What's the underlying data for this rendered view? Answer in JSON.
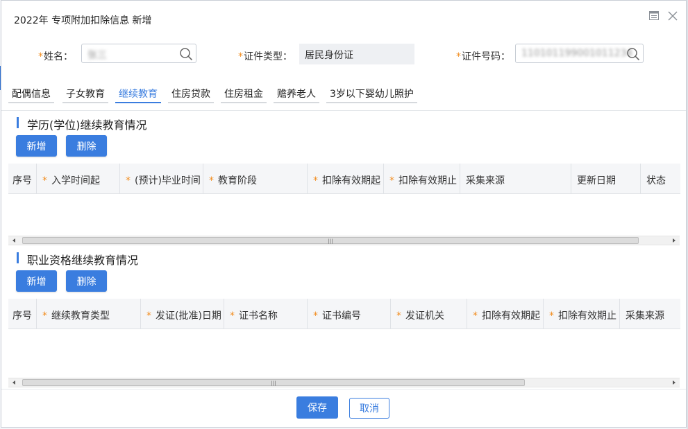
{
  "dialog": {
    "title": "2022年 专项附加扣除信息 新增"
  },
  "form": {
    "name_label": "姓名：",
    "name_value": "张三",
    "id_type_label": "证件类型：",
    "id_type_value": "居民身份证",
    "id_number_label": "证件号码：",
    "id_number_value": "110101199001011234"
  },
  "tabs": [
    {
      "label": "配偶信息"
    },
    {
      "label": "子女教育"
    },
    {
      "label": "继续教育"
    },
    {
      "label": "住房贷款"
    },
    {
      "label": "住房租金"
    },
    {
      "label": "赡养老人"
    },
    {
      "label": "3岁以下婴幼儿照护"
    }
  ],
  "active_tab": "继续教育",
  "section1": {
    "title": "学历(学位)继续教育情况",
    "add_label": "新增",
    "delete_label": "删除",
    "columns": [
      {
        "label": "序号",
        "required": false
      },
      {
        "label": "入学时间起",
        "required": true
      },
      {
        "label": "(预计)毕业时间",
        "required": true
      },
      {
        "label": "教育阶段",
        "required": true
      },
      {
        "label": "扣除有效期起",
        "required": true
      },
      {
        "label": "扣除有效期止",
        "required": true
      },
      {
        "label": "采集来源",
        "required": false
      },
      {
        "label": "更新日期",
        "required": false
      },
      {
        "label": "状态",
        "required": false
      }
    ],
    "rows": []
  },
  "section2": {
    "title": "职业资格继续教育情况",
    "add_label": "新增",
    "delete_label": "删除",
    "columns": [
      {
        "label": "序号",
        "required": false
      },
      {
        "label": "继续教育类型",
        "required": true
      },
      {
        "label": "发证(批准)日期",
        "required": true
      },
      {
        "label": "证书名称",
        "required": true
      },
      {
        "label": "证书编号",
        "required": true
      },
      {
        "label": "发证机关",
        "required": true
      },
      {
        "label": "扣除有效期起",
        "required": true
      },
      {
        "label": "扣除有效期止",
        "required": true
      },
      {
        "label": "采集来源",
        "required": false
      }
    ],
    "rows": []
  },
  "footer": {
    "save_label": "保存",
    "cancel_label": "取消"
  },
  "icons": {
    "maximize": "maximize-icon",
    "close": "close-icon",
    "search": "search-icon"
  },
  "colors": {
    "accent": "#3a7ddf",
    "required_mark": "#f28b1b"
  }
}
